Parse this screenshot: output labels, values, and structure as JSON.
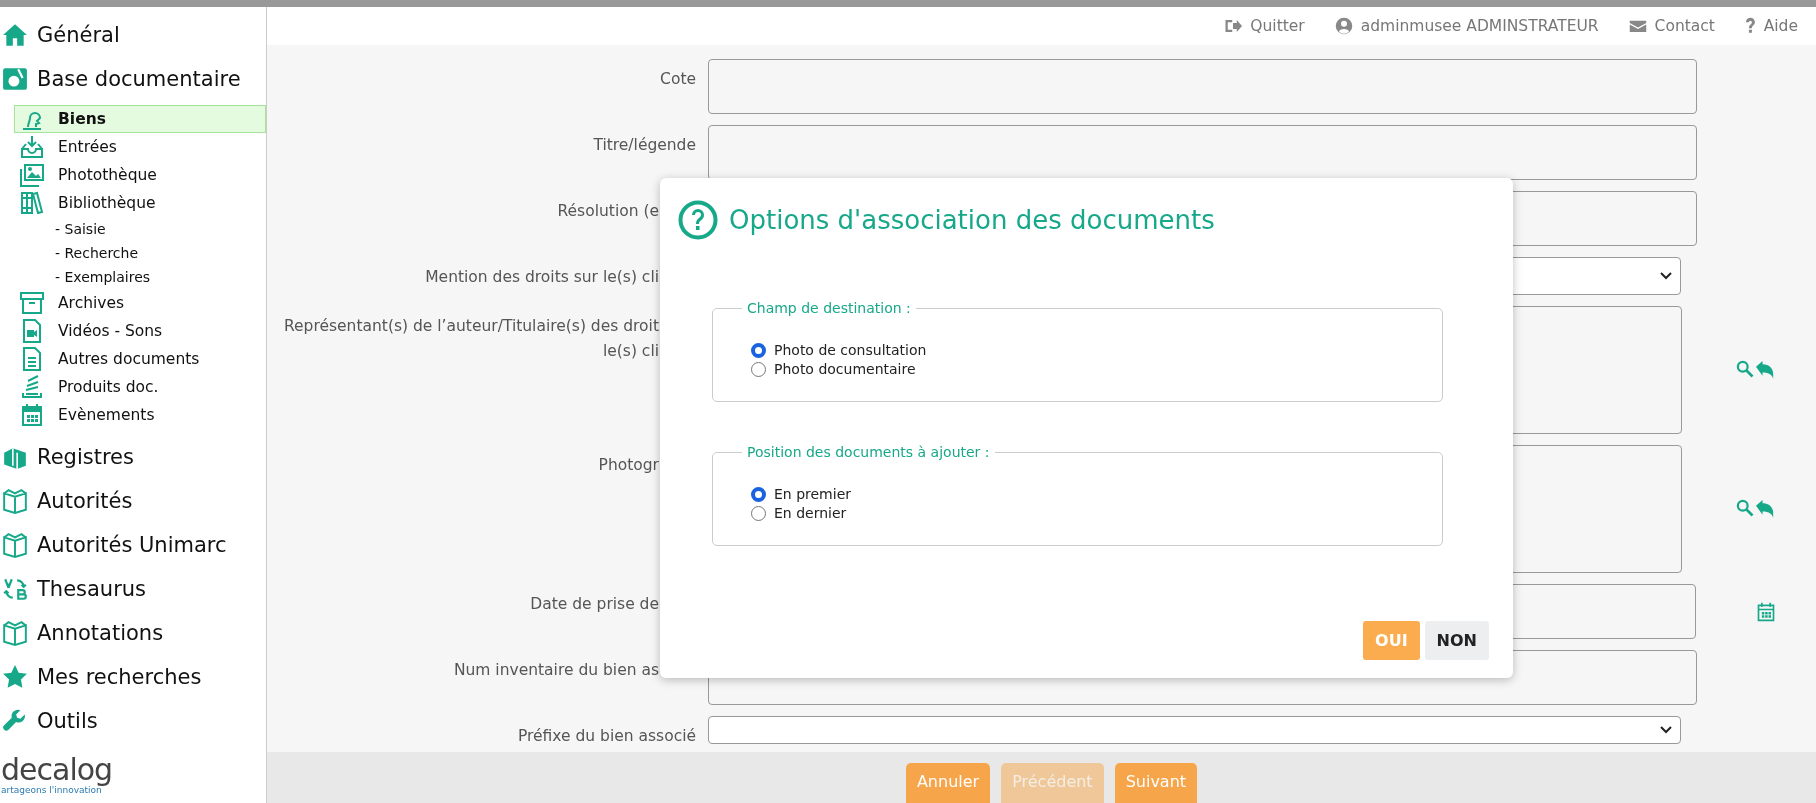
{
  "top_bar_links": [
    {
      "label": "Quitter"
    },
    {
      "label": "adminmusee ADMINSTRATEUR"
    },
    {
      "label": "Contact"
    },
    {
      "label": "Aide"
    }
  ],
  "sidebar": {
    "items": [
      {
        "label": "Général",
        "selected": false
      },
      {
        "label": "Base documentaire",
        "selected": false,
        "children": [
          {
            "label": "Biens",
            "selected": true
          },
          {
            "label": "Entrées",
            "selected": false
          },
          {
            "label": "Photothèque",
            "selected": false
          },
          {
            "label": "Bibliothèque",
            "selected": false,
            "children": [
              {
                "label": "- Saisie",
                "selected": false
              },
              {
                "label": "- Recherche",
                "selected": false
              },
              {
                "label": "- Exemplaires",
                "selected": false
              }
            ]
          },
          {
            "label": "Archives",
            "selected": false
          },
          {
            "label": "Vidéos - Sons",
            "selected": false
          },
          {
            "label": "Autres documents",
            "selected": false
          },
          {
            "label": "Produits doc.",
            "selected": false
          },
          {
            "label": "Evènements",
            "selected": false
          }
        ]
      },
      {
        "label": "Registres",
        "selected": false
      },
      {
        "label": "Autorités",
        "selected": false
      },
      {
        "label": "Autorités Unimarc",
        "selected": false
      },
      {
        "label": "Thesaurus",
        "selected": false
      },
      {
        "label": "Annotations",
        "selected": false
      },
      {
        "label": "Mes recherches",
        "selected": false
      },
      {
        "label": "Outils",
        "selected": false
      }
    ],
    "logo": {
      "name": "decalog",
      "tagline": "artageons l'innovation"
    }
  },
  "form": {
    "rows": [
      {
        "label_lines": [
          "Cote"
        ],
        "kind": "input",
        "covered": false,
        "actions": false
      },
      {
        "label_lines": [
          "Titre/légende"
        ],
        "kind": "input",
        "covered": false,
        "actions": false
      },
      {
        "label_lines": [
          "Résolution (e"
        ],
        "kind": "input",
        "covered": true,
        "actions": false
      },
      {
        "label_lines": [
          "Mention des droits sur le(s) cli"
        ],
        "kind": "select",
        "covered": true,
        "actions": false
      },
      {
        "label_lines": [
          "Représentant(s) de l’auteur/Titulaire(s) des droit",
          "le(s) cli"
        ],
        "kind": "textarea",
        "covered": true,
        "actions": true
      },
      {
        "label_lines": [
          "Photogr"
        ],
        "kind": "textarea",
        "covered": true,
        "actions": true
      },
      {
        "label_lines": [
          "Date de prise de"
        ],
        "kind": "date",
        "covered": true,
        "actions": false
      },
      {
        "label_lines": [
          "Num inventaire du bien as"
        ],
        "kind": "input",
        "covered": true,
        "actions": false
      },
      {
        "label_lines": [
          "Préfixe du bien associé"
        ],
        "kind": "select",
        "covered": false,
        "actions": false
      }
    ]
  },
  "dialog": {
    "title": "Options d'association des documents",
    "groups": [
      {
        "legend": "Champ de destination :",
        "options": [
          {
            "label": "Photo de consultation",
            "selected": true
          },
          {
            "label": "Photo documentaire",
            "selected": false
          }
        ]
      },
      {
        "legend": "Position des documents à ajouter :",
        "options": [
          {
            "label": "En premier",
            "selected": true
          },
          {
            "label": "En dernier",
            "selected": false
          }
        ]
      }
    ],
    "buttons": [
      {
        "label": "OUI",
        "kind": "primary"
      },
      {
        "label": "NON",
        "kind": "secondary"
      }
    ]
  },
  "footer_buttons": [
    {
      "label": "Annuler",
      "disabled": false
    },
    {
      "label": "Précédent",
      "disabled": true
    },
    {
      "label": "Suivant",
      "disabled": false
    }
  ]
}
